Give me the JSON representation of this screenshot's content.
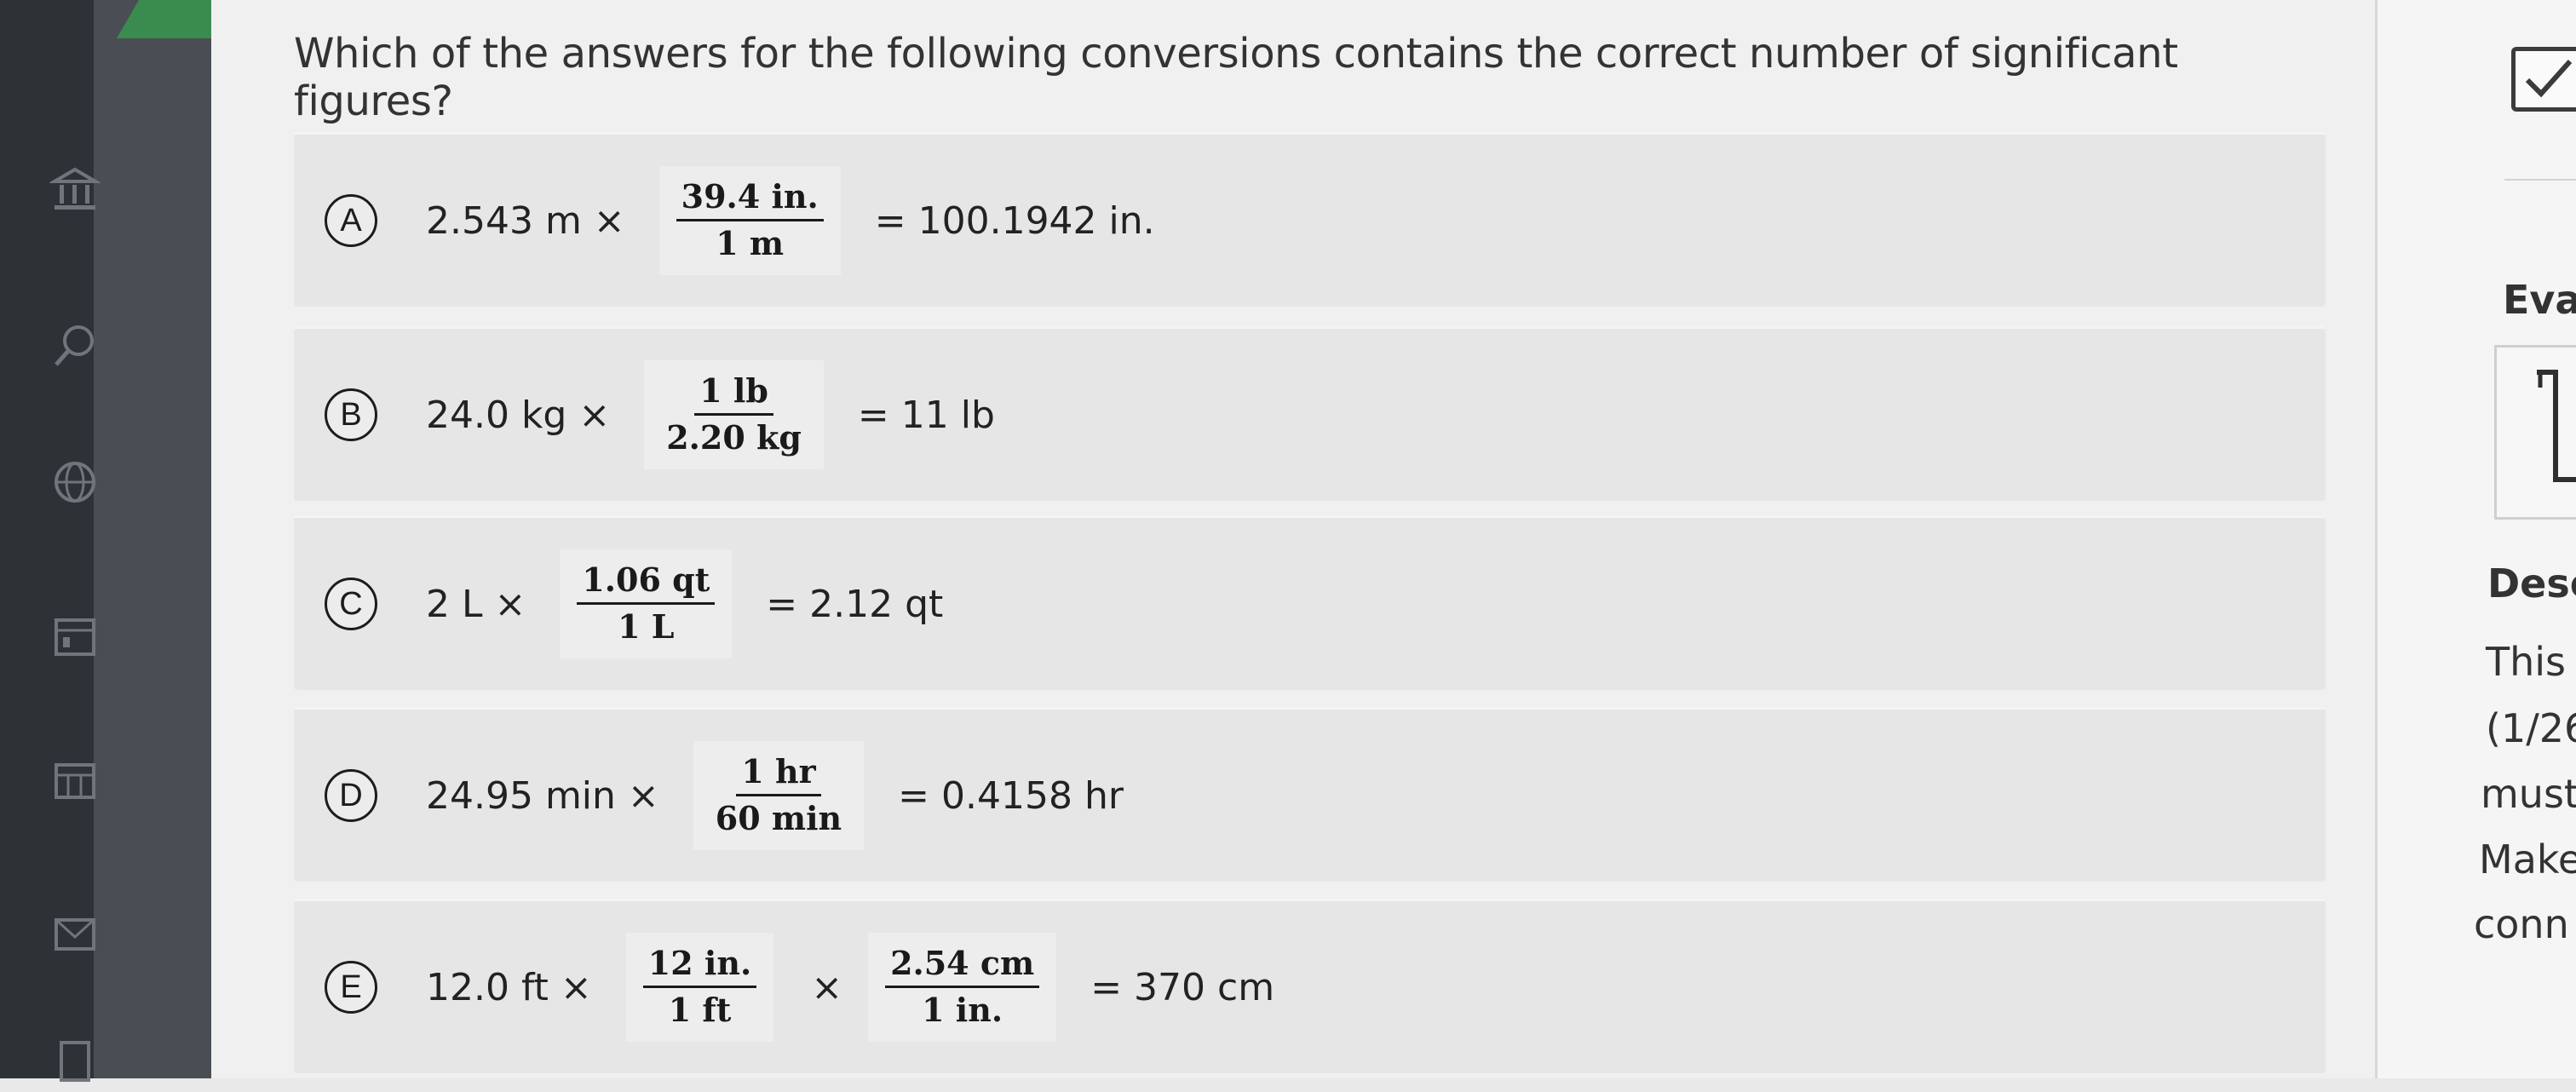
{
  "question": "Which of the answers for the following conversions contains the correct number of significant figures?",
  "choices": [
    {
      "letter": "A",
      "start": "2.543 m ×",
      "num": "39.4 in.",
      "den": "1 m",
      "end": "= 100.1942 in."
    },
    {
      "letter": "B",
      "start": "24.0 kg ×",
      "num": "1 lb",
      "den": "2.20 kg",
      "end": "= 11 lb"
    },
    {
      "letter": "C",
      "start": "2 L ×",
      "num": "1.06 qt",
      "den": "1 L",
      "end": "= 2.12 qt"
    },
    {
      "letter": "D",
      "start": "24.95 min ×",
      "num": "1 hr",
      "den": "60 min",
      "end": "= 0.4158 hr"
    },
    {
      "letter": "E",
      "start": "12.0 ft ×",
      "num": "12 in.",
      "den": "1 ft",
      "mid": "×",
      "num2": "2.54 cm",
      "den2": "1 in.",
      "end": "= 370 cm"
    }
  ],
  "right_panel": {
    "heading1": "Eva",
    "heading2": "Desc",
    "lines": [
      "This",
      "(1/26",
      "must",
      "Make",
      "conn"
    ]
  },
  "sidebar_icons": [
    "bank-icon",
    "search-icon",
    "globe-icon",
    "calendar-icon",
    "grid-icon",
    "mail-icon",
    "document-icon"
  ],
  "colors": {
    "accent_green": "#3a8c4e",
    "panel_bg": "#f0f0f1",
    "choice_bg": "#e6e6e7"
  }
}
